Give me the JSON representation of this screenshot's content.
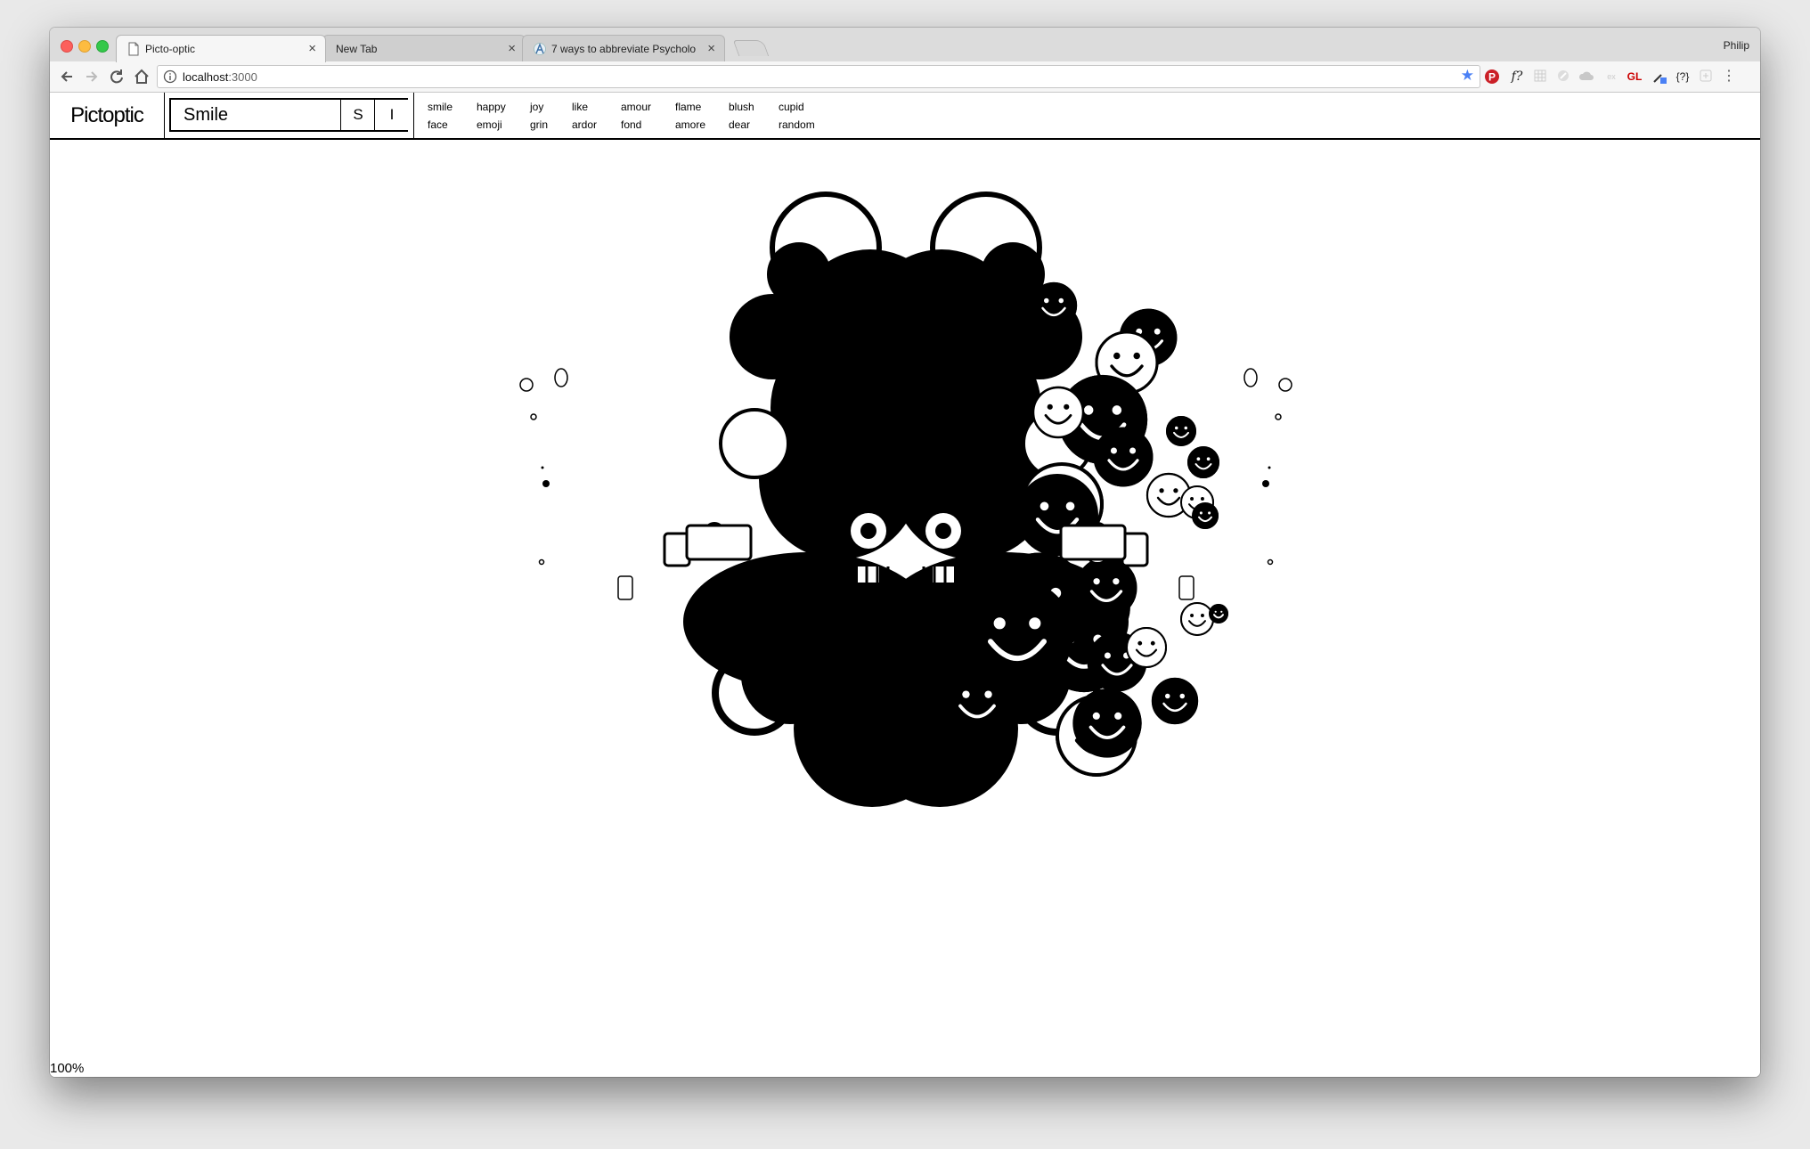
{
  "browser": {
    "tabs": [
      {
        "title": "Picto-optic",
        "active": true
      },
      {
        "title": "New Tab",
        "active": false
      },
      {
        "title": "7 ways to abbreviate Psycholo",
        "active": false
      }
    ],
    "profile_name": "Philip",
    "url_host": "localhost",
    "url_port": ":3000",
    "extension_labels": [
      "f?",
      "GL",
      "{?}",
      "ex"
    ]
  },
  "app": {
    "logo": "Pictoptic",
    "search_value": "Smile",
    "buttons": {
      "s": "S",
      "i": "I"
    },
    "keywords": [
      [
        "smile",
        "happy",
        "joy",
        "like",
        "amour",
        "flame",
        "blush",
        "cupid"
      ],
      [
        "face",
        "emoji",
        "grin",
        "ardor",
        "fond",
        "amore",
        "dear",
        "random"
      ]
    ],
    "zoom_label": "100%"
  }
}
